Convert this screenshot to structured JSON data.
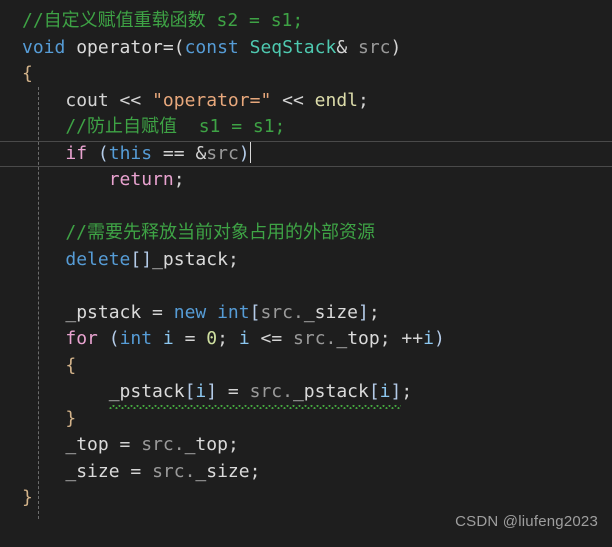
{
  "editor": {
    "background": "#1e1e1e",
    "language": "cpp",
    "font_size_px": 18,
    "line_height_px": 26.5,
    "current_line_index": 5,
    "cursor": {
      "line_index": 5,
      "after_text": "if (this == &src)"
    },
    "colors": {
      "comment": "#3ea345",
      "keyword": "#569cd6",
      "control": "#e9a3d0",
      "type": "#4ec9b0",
      "string": "#e8a87c",
      "number": "#cfe0a0",
      "function": "#dcdcaa",
      "brace": "#d3b38a",
      "punctuation": "#b4cbe8",
      "identifier": "#dadada",
      "member_dim": "#9a9a9a",
      "squiggle": "#44a33f",
      "current_line_border": "#4a4a4a",
      "indent_guide": "#868686"
    },
    "lines": [
      {
        "index": 0,
        "text": "//自定义赋值重载函数 s2 = s1;"
      },
      {
        "index": 1,
        "text": "void operator=(const SeqStack& src)"
      },
      {
        "index": 2,
        "text": "{"
      },
      {
        "index": 3,
        "text": "    cout << \"operator=\" << endl;"
      },
      {
        "index": 4,
        "text": "    //防止自赋值  s1 = s1;"
      },
      {
        "index": 5,
        "text": "    if (this == &src)"
      },
      {
        "index": 6,
        "text": "        return;"
      },
      {
        "index": 7,
        "text": ""
      },
      {
        "index": 8,
        "text": "    //需要先释放当前对象占用的外部资源"
      },
      {
        "index": 9,
        "text": "    delete[]_pstack;"
      },
      {
        "index": 10,
        "text": ""
      },
      {
        "index": 11,
        "text": "    _pstack = new int[src._size];"
      },
      {
        "index": 12,
        "text": "    for (int i = 0; i <= src._top; ++i)"
      },
      {
        "index": 13,
        "text": "    {"
      },
      {
        "index": 14,
        "text": "        _pstack[i] = src._pstack[i];"
      },
      {
        "index": 15,
        "text": "    }"
      },
      {
        "index": 16,
        "text": "    _top = src._top;"
      },
      {
        "index": 17,
        "text": "    _size = src._size;"
      },
      {
        "index": 18,
        "text": "}"
      }
    ],
    "tokens": {
      "l0_comment": "//自定义赋值重载函数 s2 = s1;",
      "l1_void": "void",
      "l1_operator": " operator=(",
      "l1_const": "const",
      "l1_space": " ",
      "l1_type": "SeqStack",
      "l1_amp": "& ",
      "l1_src": "src",
      "l1_close": ")",
      "l2_brace": "{",
      "l3_indent": "    ",
      "l3_cout": "cout",
      "l3_shift1": " << ",
      "l3_string": "\"operator=\"",
      "l3_shift2": " << ",
      "l3_endl": "endl",
      "l3_semi": ";",
      "l4_comment": "    //防止自赋值  s1 = s1;",
      "l5_indent": "    ",
      "l5_if": "if",
      "l5_open": " (",
      "l5_this": "this",
      "l5_eq": " == &",
      "l5_src": "src",
      "l5_close": ")",
      "l6_indent": "        ",
      "l6_return": "return",
      "l6_semi": ";",
      "l8_comment": "    //需要先释放当前对象占用的外部资源",
      "l9_indent": "    ",
      "l9_delete": "delete",
      "l9_brackets": "[]",
      "l9_pstack": "_pstack",
      "l9_semi": ";",
      "l11_indent": "    ",
      "l11_pstack": "_pstack",
      "l11_assign": " = ",
      "l11_new": "new",
      "l11_space": " ",
      "l11_int": "int",
      "l11_ob": "[",
      "l11_src": "src.",
      "l11_size": "_size",
      "l11_cb": "]",
      "l11_semi": ";",
      "l12_indent": "    ",
      "l12_for": "for",
      "l12_open": " (",
      "l12_int": "int",
      "l12_i1": " i",
      "l12_assign": " = ",
      "l12_zero": "0",
      "l12_semi1": "; ",
      "l12_i2": "i",
      "l12_le": " <= ",
      "l12_src": "src.",
      "l12_top": "_top",
      "l12_semi2": "; ",
      "l12_inc": "++",
      "l12_i3": "i",
      "l12_close": ")",
      "l13_brace": "    {",
      "l14_indent": "        ",
      "l14_pstack1": "_pstack",
      "l14_ob1": "[",
      "l14_i1": "i",
      "l14_cb1": "]",
      "l14_assign": " = ",
      "l14_src": "src.",
      "l14_pstack2": "_pstack",
      "l14_ob2": "[",
      "l14_i2": "i",
      "l14_cb2": "]",
      "l14_semi": ";",
      "l15_brace": "    }",
      "l16_indent": "    ",
      "l16_top": "_top",
      "l16_assign": " = ",
      "l16_src": "src.",
      "l16_srctop": "_top",
      "l16_semi": ";",
      "l17_indent": "    ",
      "l17_size": "_size",
      "l17_assign": " = ",
      "l17_src": "src.",
      "l17_srcsize": "_size",
      "l17_semi": ";",
      "l18_brace": "}"
    }
  },
  "watermark": {
    "text": "CSDN @liufeng2023"
  }
}
